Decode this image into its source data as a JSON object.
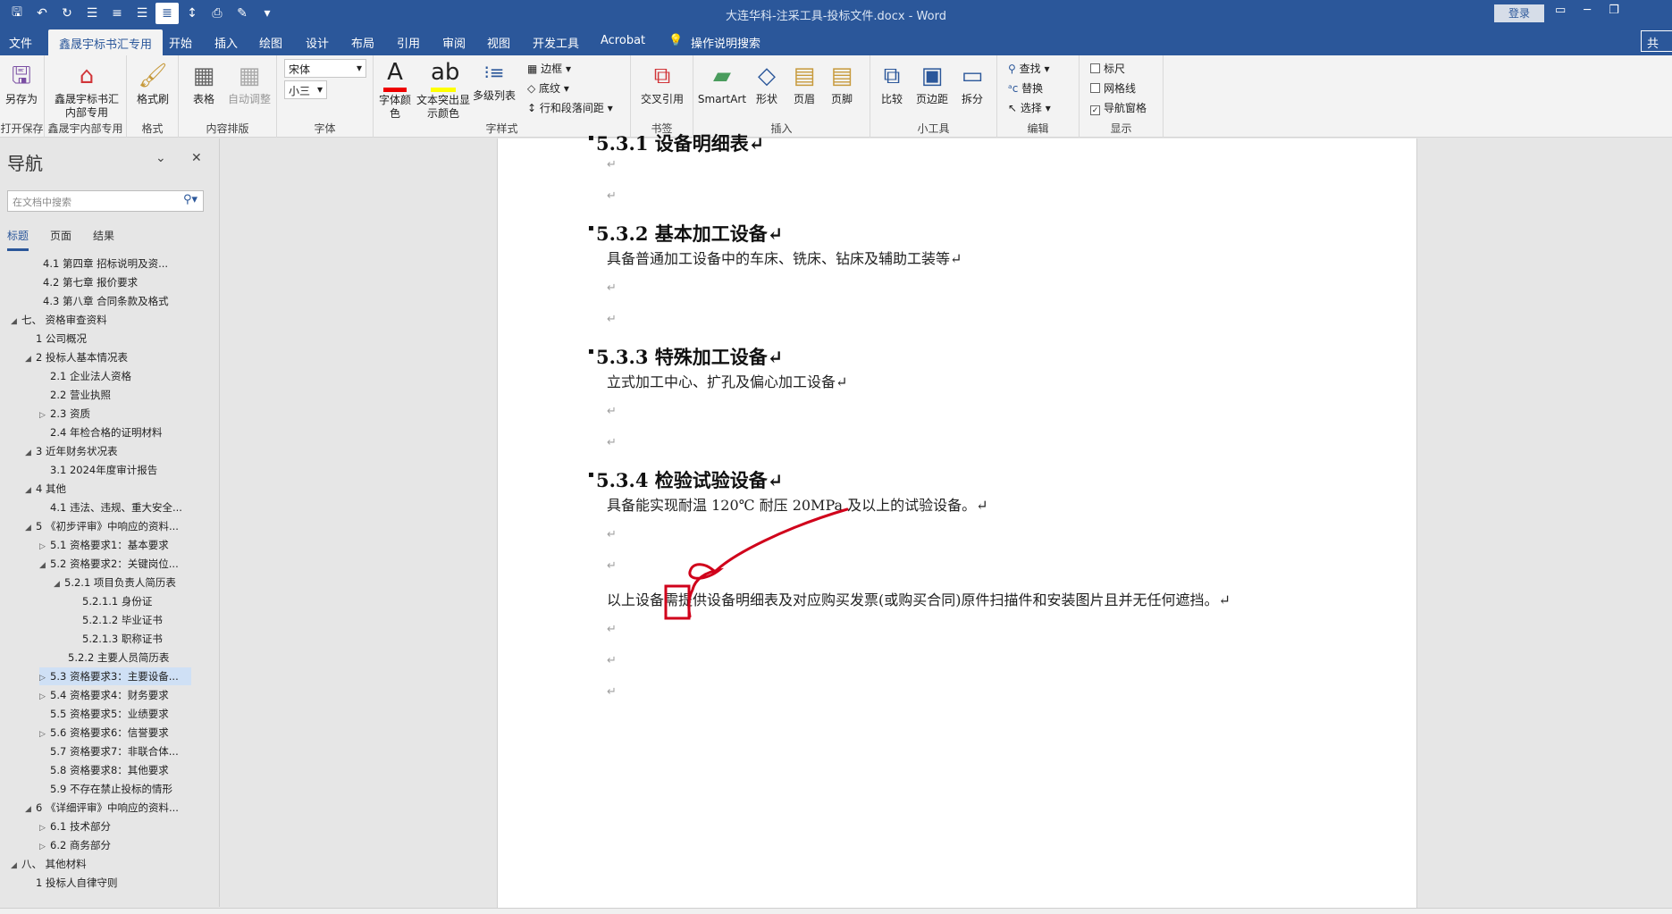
{
  "window": {
    "title": "大连华科-注采工具-投标文件.docx - Word",
    "login_label": "登录",
    "share_label": "共"
  },
  "qat": {
    "icons": [
      "save-icon",
      "undo-icon",
      "redo-icon",
      "align-left-icon",
      "align-center-icon",
      "align-right-icon",
      "justify-icon",
      "line-spacing-icon",
      "save-as-icon",
      "format-painter-icon",
      "customize-icon"
    ]
  },
  "tabs": [
    "文件",
    "鑫晟宇标书汇专用",
    "开始",
    "插入",
    "绘图",
    "设计",
    "布局",
    "引用",
    "审阅",
    "视图",
    "开发工具",
    "Acrobat"
  ],
  "tell_me": "操作说明搜索",
  "ribbon": {
    "save_as": "另存为",
    "xsy_special": "鑫晟宇标书汇内部专用",
    "format_painter": "格式刷",
    "table": "表格",
    "auto_adjust": "自动调整",
    "font_name": "宋体",
    "font_size": "小三",
    "font_color": "字体颜色",
    "highlight": "文本突出显示颜色",
    "multilevel": "多级列表",
    "border": "边框",
    "shading": "底纹",
    "para_spacing": "行和段落间距",
    "cross_ref": "交叉引用",
    "smartart": "SmartArt",
    "shape": "形状",
    "header": "页眉",
    "footer": "页脚",
    "compare": "比较",
    "margins": "页边距",
    "split": "拆分",
    "find": "查找",
    "replace": "替换",
    "select": "选择",
    "ruler": "标尺",
    "gridlines": "网格线",
    "nav_pane": "导航窗格",
    "groups": [
      "打开保存",
      "鑫晟宇内部专用",
      "格式",
      "内容排版",
      "字体",
      "字样式",
      "书签",
      "插入",
      "小工具",
      "编辑",
      "显示"
    ]
  },
  "nav": {
    "title": "导航",
    "search_placeholder": "在文档中搜索",
    "tabs": [
      "标题",
      "页面",
      "结果"
    ],
    "items": [
      "4.1 第四章  招标说明及资...",
      "4.2 第七章  报价要求",
      "4.3 第八章  合同条款及格式",
      "七、 资格审查资料",
      "1 公司概况",
      "2 投标人基本情况表",
      "2.1 企业法人资格",
      "2.2 营业执照",
      "2.3 资质",
      "2.4 年检合格的证明材料",
      "3 近年财务状况表",
      "3.1 2024年度审计报告",
      "4 其他",
      "4.1 违法、违规、重大安全...",
      "5 《初步评审》中响应的资料...",
      "5.1 资格要求1：基本要求",
      "5.2 资格要求2：关键岗位...",
      "5.2.1 项目负责人简历表",
      "5.2.1.1 身份证",
      "5.2.1.2 毕业证书",
      "5.2.1.3 职称证书",
      "5.2.2 主要人员简历表",
      "5.3 资格要求3：主要设备...",
      "5.4 资格要求4：财务要求",
      "5.5 资格要求5：业绩要求",
      "5.6 资格要求6：信誉要求",
      "5.7 资格要求7：非联合体...",
      "5.8 资格要求8：其他要求",
      "5.9 不存在禁止投标的情形",
      "6 《详细评审》中响应的资料...",
      "6.1 技术部分",
      "6.2 商务部分",
      "八、 其他材料",
      "1 投标人自律守则"
    ]
  },
  "doc": {
    "h_531": "5.3.1 设备明细表↵",
    "h_532": "5.3.2 基本加工设备↵",
    "p_532": "具备普通加工设备中的车床、铣床、钻床及辅助工装等↵",
    "h_533": "5.3.3 特殊加工设备↵",
    "p_533": "立式加工中心、扩孔及偏心加工设备↵",
    "h_534": "5.3.4 检验试验设备↵",
    "p_534": "具备能实现耐温 120℃ 耐压 20MPa 及以上的试验设备。↵",
    "p_final": "以上设备需提供设备明细表及对应购买发票(或购买合同)原件扫描件和安装图片且并无任何遮挡。↵",
    "para_mark": "↵"
  },
  "annotation_color": "#d0021b"
}
